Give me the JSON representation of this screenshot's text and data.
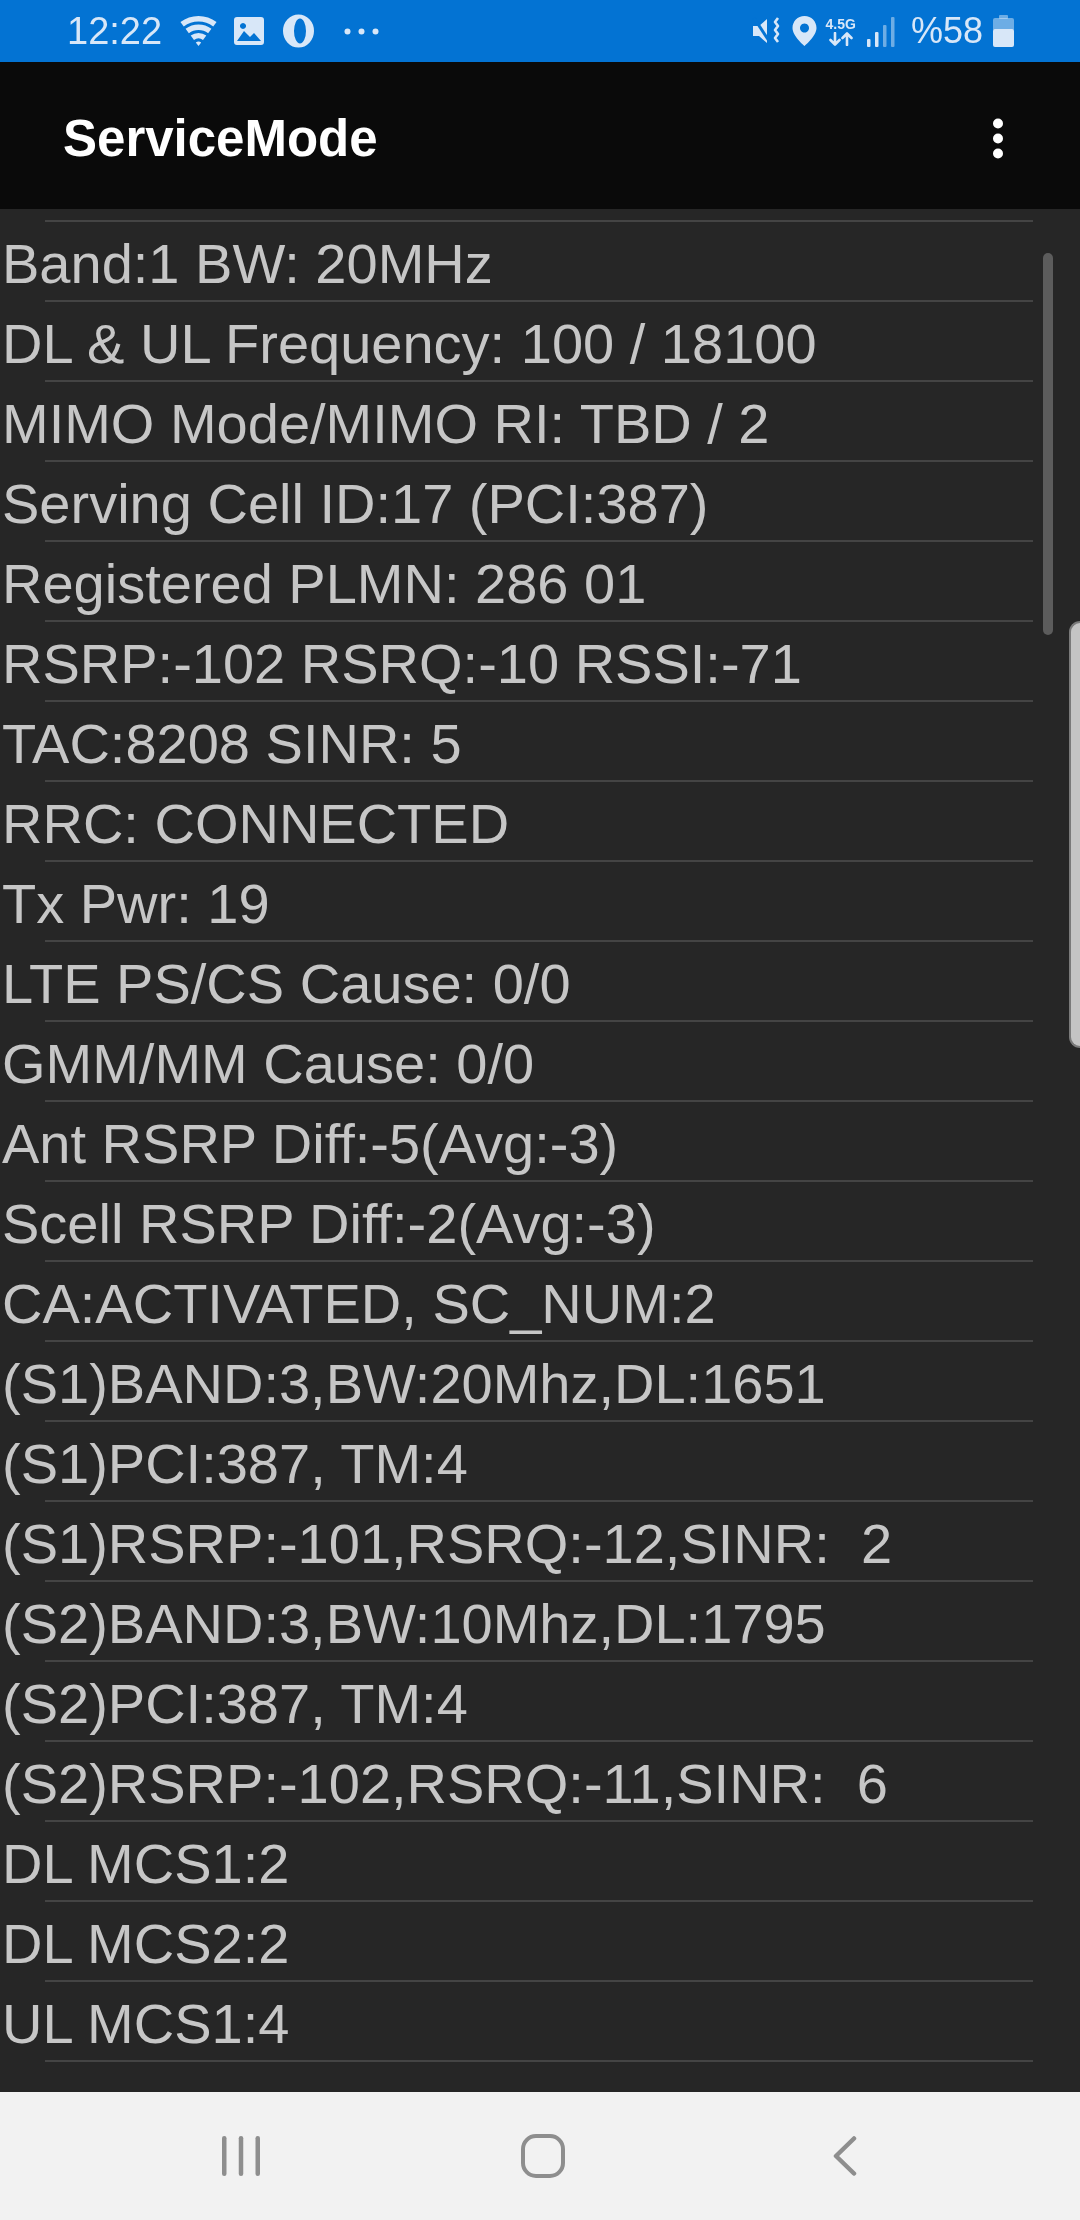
{
  "status_bar": {
    "time": "12:22",
    "network_type": "4.5G",
    "battery_percent": "%58"
  },
  "app_bar": {
    "title": "ServiceMode"
  },
  "rows": [
    "Band:1 BW: 20MHz",
    "DL & UL Frequency: 100 / 18100",
    "MIMO Mode/MIMO RI: TBD / 2",
    "Serving Cell ID:17 (PCI:387)",
    "Registered PLMN: 286 01",
    "RSRP:-102 RSRQ:-10 RSSI:-71",
    "TAC:8208 SINR: 5",
    "RRC: CONNECTED",
    "Tx Pwr: 19",
    "LTE PS/CS Cause: 0/0",
    "GMM/MM Cause: 0/0",
    "Ant RSRP Diff:-5(Avg:-3)",
    "Scell RSRP Diff:-2(Avg:-3)",
    "CA:ACTIVATED, SC_NUM:2",
    "(S1)BAND:3,BW:20Mhz,DL:1651",
    "(S1)PCI:387, TM:4",
    "(S1)RSRP:-101,RSRQ:-12,SINR:  2",
    "(S2)BAND:3,BW:10Mhz,DL:1795",
    "(S2)PCI:387, TM:4",
    "(S2)RSRP:-102,RSRQ:-11,SINR:  6",
    "DL MCS1:2",
    "DL MCS2:2",
    "UL MCS1:4"
  ]
}
